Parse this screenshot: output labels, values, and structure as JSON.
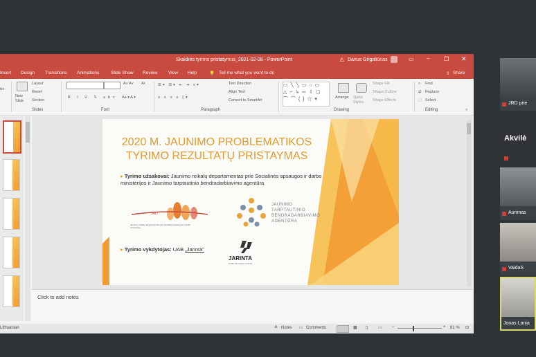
{
  "window": {
    "title": "Skaidrės tyrimo pristatymus_2021-02-08 - PowerPoint",
    "user": "Darius Grigaliūnas",
    "share_label": "Share",
    "tell_me": "Tell me what you want to do"
  },
  "ribbon_tabs": [
    "Insert",
    "Design",
    "Transitions",
    "Animations",
    "Slide Show",
    "Review",
    "View",
    "Help"
  ],
  "ribbon": {
    "slides": {
      "new_slide": "New Slide",
      "layout": "Layout",
      "reset": "Reset",
      "section": "Section",
      "label": "Slides",
      "paste_stub": "ter"
    },
    "font": {
      "label": "Font"
    },
    "paragraph": {
      "text_direction": "Text Direction",
      "align_text": "Align Text",
      "convert_smartart": "Convert to SmartArt",
      "label": "Paragraph"
    },
    "drawing": {
      "arrange": "Arrange",
      "quick_styles": "Quick Styles",
      "shape_fill": "Shape Fill",
      "shape_outline": "Shape Outline",
      "shape_effects": "Shape Effects",
      "label": "Drawing"
    },
    "editing": {
      "find": "Find",
      "replace": "Replace",
      "select": "Select",
      "label": "Editing"
    }
  },
  "slide": {
    "title_line1": "2020 M. JAUNIMO PROBLEMATIKOS",
    "title_line2": "TYRIMO REZULTATŲ PRISTAYMAS",
    "bullet1_label": "Tyrimo užsakovai:",
    "bullet1_text": "Jaunimo reikalų departamentas prie Socialinės apsaugos ir darbo ministerijos ir Jaunimo tarptautinio bendradarbiavimo agentūra",
    "jrd_logo_text": "JRD",
    "jrd_caption": "Jaunimo reikalų departamentas prie Socialinės apsaugos ir darbo ministerijos",
    "agency_line1": "JAUNIMO",
    "agency_line2": "TARPTAUTINIO",
    "agency_line3": "BENDRADARBIAVIMO",
    "agency_line4": "AGENTŪRA",
    "bullet2_label": "Tyrimo vykdytojas:",
    "bullet2_text": "UAB ",
    "bullet2_link": "„Jarinta\"",
    "jarinta_name": "JARINTA",
    "jarinta_tagline": "Under the market of limits"
  },
  "notes_placeholder": "Click to add notes",
  "status": {
    "language": "Lithuanian",
    "notes": "Notes",
    "comments": "Comments",
    "zoom": "61 %"
  },
  "participants": {
    "p1": "JRD prie",
    "heading": "Akvilė",
    "p2": "Aurimas",
    "p3": "VaidaS",
    "p4": "Jonas Lania"
  },
  "colors": {
    "title_bar": "#c94a3f",
    "slide_title": "#e39a2d",
    "accent_orange": "#f29a34"
  }
}
